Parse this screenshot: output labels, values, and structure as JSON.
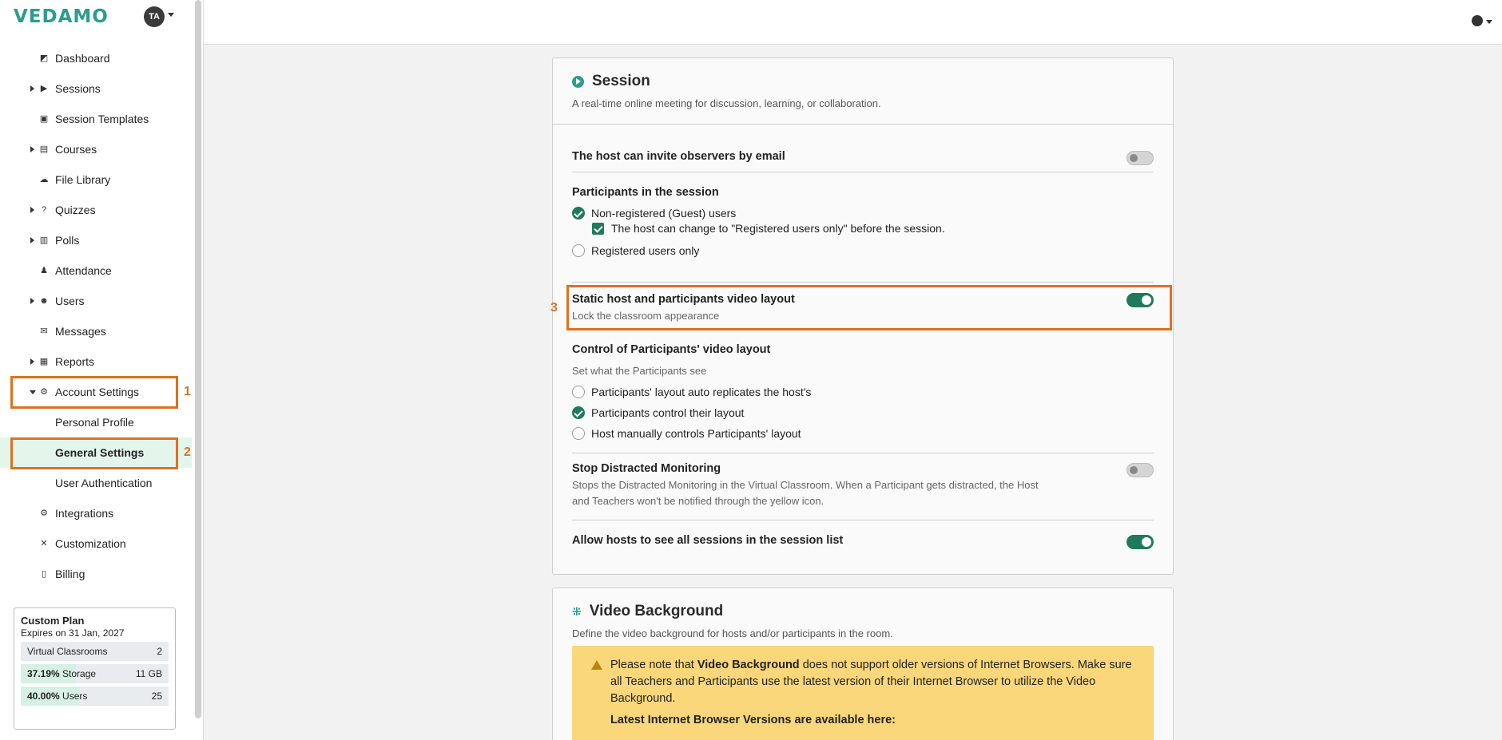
{
  "sidebar": {
    "logo": "VEDAMO",
    "avatar": "TA",
    "items": [
      {
        "label": "Dashboard",
        "icon": "dashboard-icon"
      },
      {
        "label": "Sessions",
        "icon": "play-circle-icon"
      },
      {
        "label": "Session Templates",
        "icon": "template-icon"
      },
      {
        "label": "Courses",
        "icon": "book-icon"
      },
      {
        "label": "File Library",
        "icon": "cloud-upload-icon"
      },
      {
        "label": "Quizzes",
        "icon": "question-circle-icon"
      },
      {
        "label": "Polls",
        "icon": "poll-chart-icon"
      },
      {
        "label": "Attendance",
        "icon": "attendance-icon"
      },
      {
        "label": "Users",
        "icon": "users-icon"
      },
      {
        "label": "Messages",
        "icon": "envelope-icon"
      },
      {
        "label": "Reports",
        "icon": "report-chart-icon"
      },
      {
        "label": "Account Settings",
        "icon": "gear-icon"
      },
      {
        "label": "Personal Profile"
      },
      {
        "label": "General Settings"
      },
      {
        "label": "User Authentication"
      },
      {
        "label": "Integrations",
        "icon": "cogs-icon"
      },
      {
        "label": "Customization",
        "icon": "tools-icon"
      },
      {
        "label": "Billing",
        "icon": "invoice-icon"
      }
    ],
    "annotations": [
      "1",
      "2"
    ],
    "plan": {
      "title": "Custom Plan",
      "expires": "Expires on 31 Jan, 2027",
      "rows": [
        {
          "pct_label": "",
          "label": "Virtual Classrooms",
          "value": "2",
          "fraction": 0
        },
        {
          "pct_label": "37.19%",
          "label": "Storage",
          "value": "11 GB",
          "fraction": 0.3719
        },
        {
          "pct_label": "40.00%",
          "label": "Users",
          "value": "25",
          "fraction": 0.4
        }
      ]
    }
  },
  "topbar": {
    "language_icon": "globe-icon"
  },
  "session_card": {
    "title": "Session",
    "description": "A real-time online meeting for discussion, learning, or collaboration.",
    "invite_observers": "The host can invite observers by email",
    "participants_heading": "Participants in the session",
    "opt_guests": "Non-registered (Guest) users",
    "opt_change": "The host can change to \"Registered users only\" before the session.",
    "opt_registered": "Registered users only",
    "static_layout_title": "Static host and participants video layout",
    "static_layout_sub": "Lock the classroom appearance",
    "annotation": "3",
    "control_title": "Control of Participants' video layout",
    "control_sub": "Set what the Participants see",
    "control_opt1": "Participants' layout auto replicates the host's",
    "control_opt2": "Participants control their layout",
    "control_opt3": "Host manually controls Participants' layout",
    "distracted_title": "Stop Distracted Monitoring",
    "distracted_sub1": "Stops the Distracted Monitoring in the Virtual Classroom. When a Participant gets distracted, the Host",
    "distracted_sub2": "and Teachers won't be notified through the yellow icon.",
    "all_sessions": "Allow hosts to see all sessions in the session list"
  },
  "video_card": {
    "title": "Video Background",
    "description": "Define the video background for hosts and/or participants in the room.",
    "note_pre": "Please note that ",
    "note_bold": "Video Background",
    "note_post": " does not support older versions of Internet Browsers. Make sure all Teachers and Participants use the latest version of their Internet Browser to utilize the Video Background.",
    "latest": "Latest Internet Browser Versions are available here:"
  }
}
